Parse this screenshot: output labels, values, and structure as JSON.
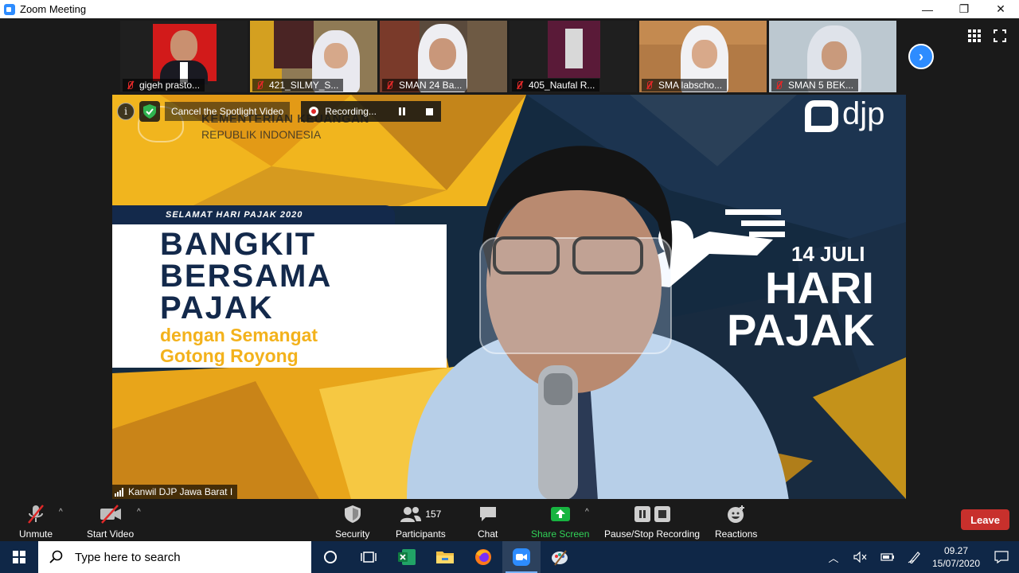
{
  "window": {
    "title": "Zoom Meeting",
    "minimize": "—",
    "maximize": "❐",
    "close": "✕"
  },
  "participants": [
    {
      "name": "gigeh prasto..."
    },
    {
      "name": "421_SILMY_S..."
    },
    {
      "name": "SMAN 24 Ba..."
    },
    {
      "name": "405_Naufal R..."
    },
    {
      "name": "SMA labscho..."
    },
    {
      "name": "SMAN 5 BEK..."
    }
  ],
  "main_video": {
    "spotlight_label": "Cancel the Spotlight Video",
    "recording_label": "Recording...",
    "speaker_name": "Kanwil DJP Jawa Barat I",
    "banner": {
      "ministry_line1": "KEMENTERIAN KEUANGAN",
      "ministry_line2": "REPUBLIK INDONESIA",
      "ribbon": "SELAMAT HARI PAJAK 2020",
      "headline1": "BANGKIT",
      "headline2": "BERSAMA",
      "headline3": "PAJAK",
      "sub1": "dengan Semangat",
      "sub2": "Gotong Royong",
      "logo_text": "djp",
      "date": "14 JULI",
      "hari": "HARI",
      "pajak": "PAJAK"
    }
  },
  "toolbar": {
    "unmute": "Unmute",
    "start_video": "Start Video",
    "security": "Security",
    "participants": "Participants",
    "participants_count": "157",
    "chat": "Chat",
    "share_screen": "Share Screen",
    "pause_stop_recording": "Pause/Stop Recording",
    "reactions": "Reactions",
    "leave": "Leave"
  },
  "taskbar": {
    "search_placeholder": "Type here to search",
    "time": "09.27",
    "date": "15/07/2020"
  },
  "colors": {
    "zoom_blue": "#2d8cff",
    "share_green": "#17b440",
    "leave_red": "#c8302c",
    "banner_navy": "#13294b",
    "banner_gold": "#f3b21c"
  }
}
